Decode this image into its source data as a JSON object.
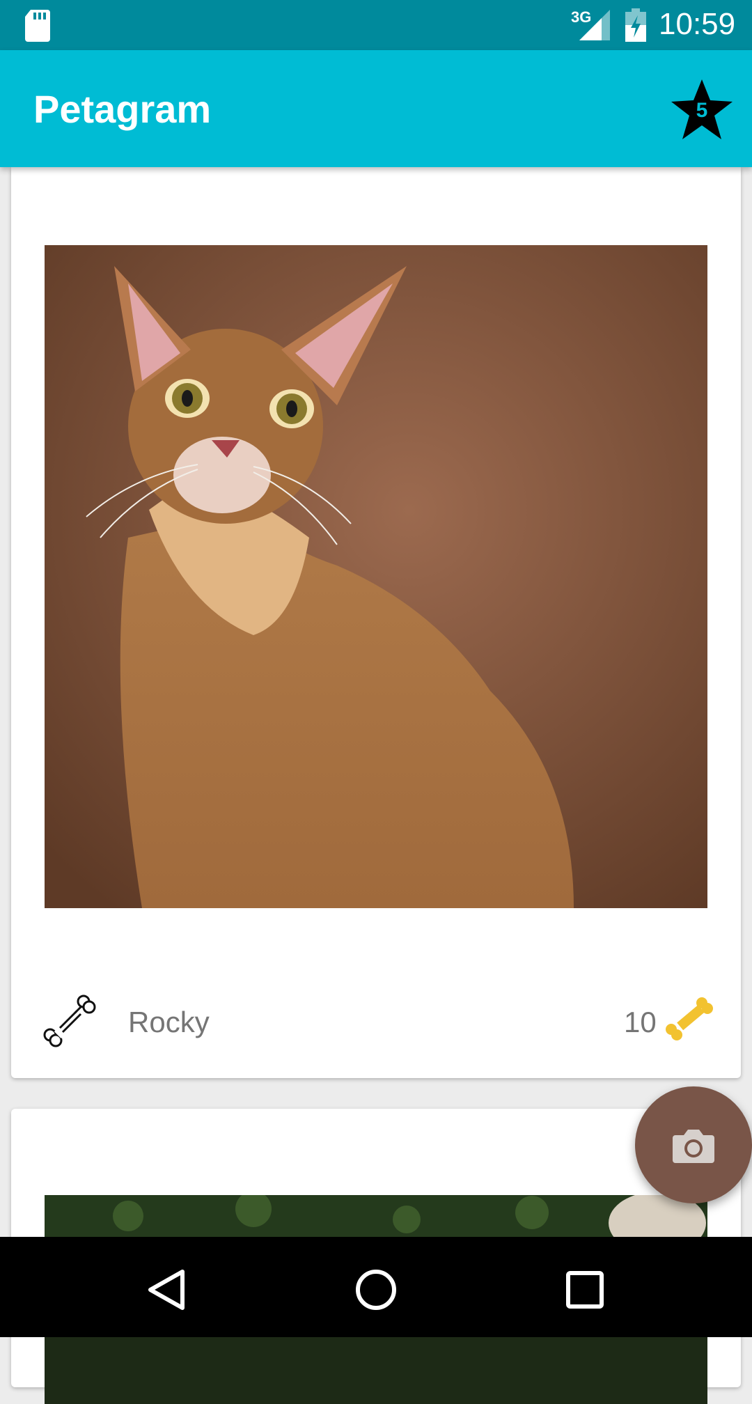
{
  "status_bar": {
    "network": "3G",
    "time": "10:59"
  },
  "app_bar": {
    "title": "Petagram",
    "favorites_count": "5",
    "accent_color": "#00bcd4"
  },
  "pets": [
    {
      "name": "Rocky",
      "likes": "10",
      "photo_icon": "cat-photo"
    },
    {
      "name": "",
      "likes": "",
      "photo_icon": "pet-photo-outdoor"
    }
  ],
  "fab": {
    "icon": "camera-icon",
    "color": "#795548"
  },
  "nav": {
    "back_icon": "back-icon",
    "home_icon": "home-icon",
    "recents_icon": "recents-icon"
  }
}
